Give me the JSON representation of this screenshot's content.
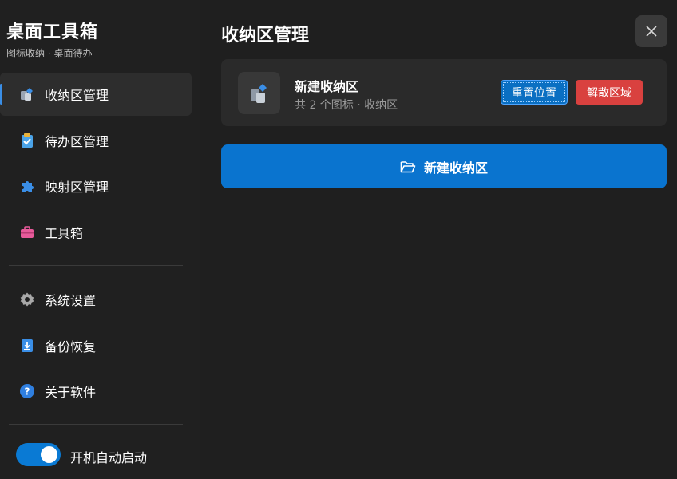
{
  "sidebar": {
    "brand_title": "桌面工具箱",
    "brand_subtitle": "图标收纳 · 桌面待办",
    "nav": [
      {
        "label": "收纳区管理",
        "icon": "storage-icon",
        "active": true
      },
      {
        "label": "待办区管理",
        "icon": "clipboard-icon",
        "active": false
      },
      {
        "label": "映射区管理",
        "icon": "puzzle-icon",
        "active": false
      },
      {
        "label": "工具箱",
        "icon": "toolbox-icon",
        "active": false
      },
      {
        "label": "系统设置",
        "icon": "gear-icon",
        "active": false
      },
      {
        "label": "备份恢复",
        "icon": "backup-icon",
        "active": false
      },
      {
        "label": "关于软件",
        "icon": "help-icon",
        "active": false
      }
    ],
    "autostart": {
      "label": "开机自动启动",
      "enabled": true
    }
  },
  "main": {
    "title": "收纳区管理",
    "card": {
      "title": "新建收纳区",
      "subtitle": "共 2 个图标 · 收纳区",
      "reset_label": "重置位置",
      "dissolve_label": "解散区域"
    },
    "new_button_label": "新建收纳区"
  },
  "colors": {
    "accent": "#0a74cf",
    "danger": "#d9413f",
    "background": "#1f1f1f"
  }
}
